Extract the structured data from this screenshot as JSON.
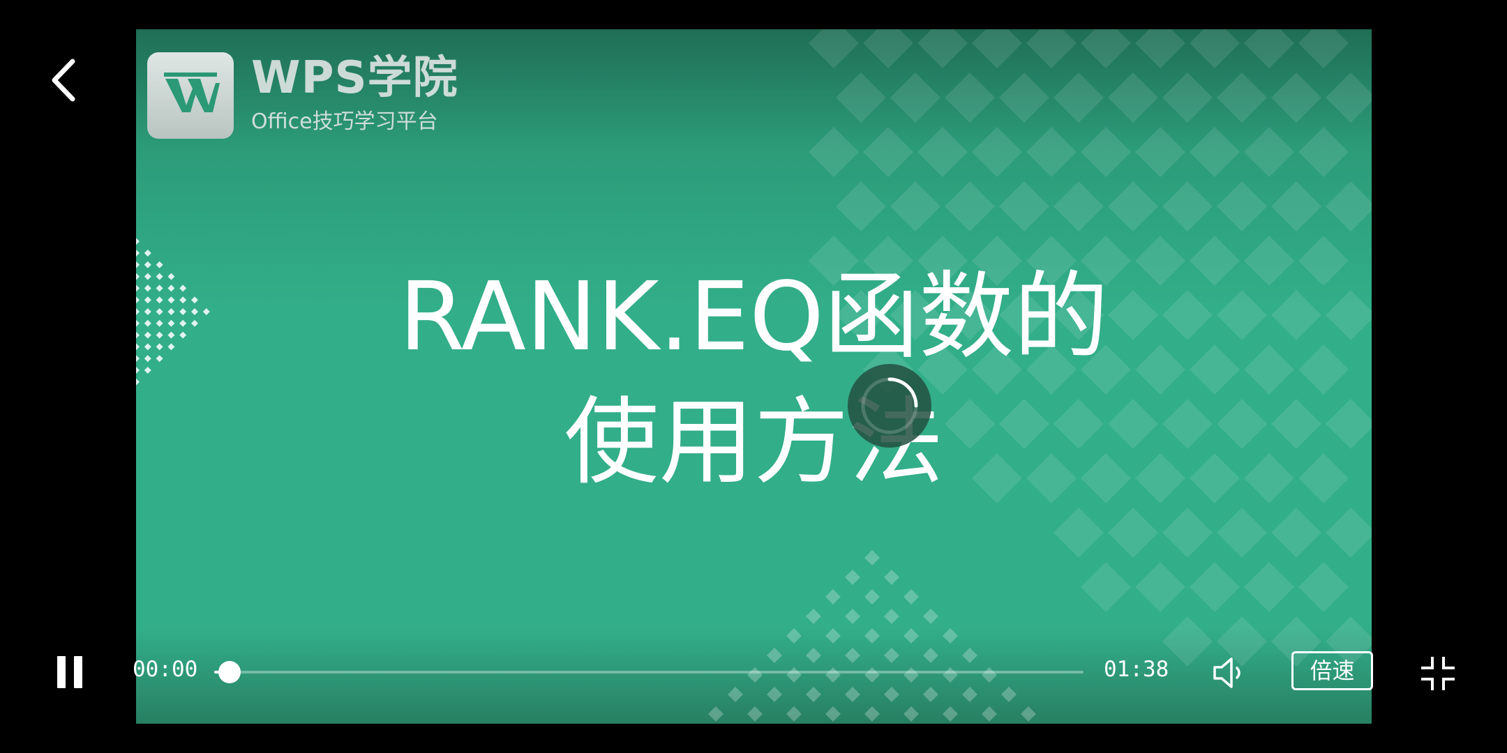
{
  "video": {
    "brand_title": "WPS学院",
    "brand_subtitle": "Office技巧学习平台",
    "title_line_1": "RANK.EQ函数的",
    "title_line_2": "使用方法"
  },
  "controls": {
    "current_time": "00:00",
    "total_time": "01:38",
    "progress_fraction": 0.018,
    "speed_label": "倍速"
  },
  "icons": {
    "back": "back-arrow-icon",
    "pause": "pause-icon",
    "volume": "volume-icon",
    "exit_fullscreen": "exit-fullscreen-icon",
    "loading": "loading-spinner-icon",
    "logo": "wps-logo-icon"
  },
  "colors": {
    "video_background": "#32ae89",
    "video_top": "#1f6e55",
    "player_background": "#000000",
    "control_foreground": "#ffffff"
  }
}
